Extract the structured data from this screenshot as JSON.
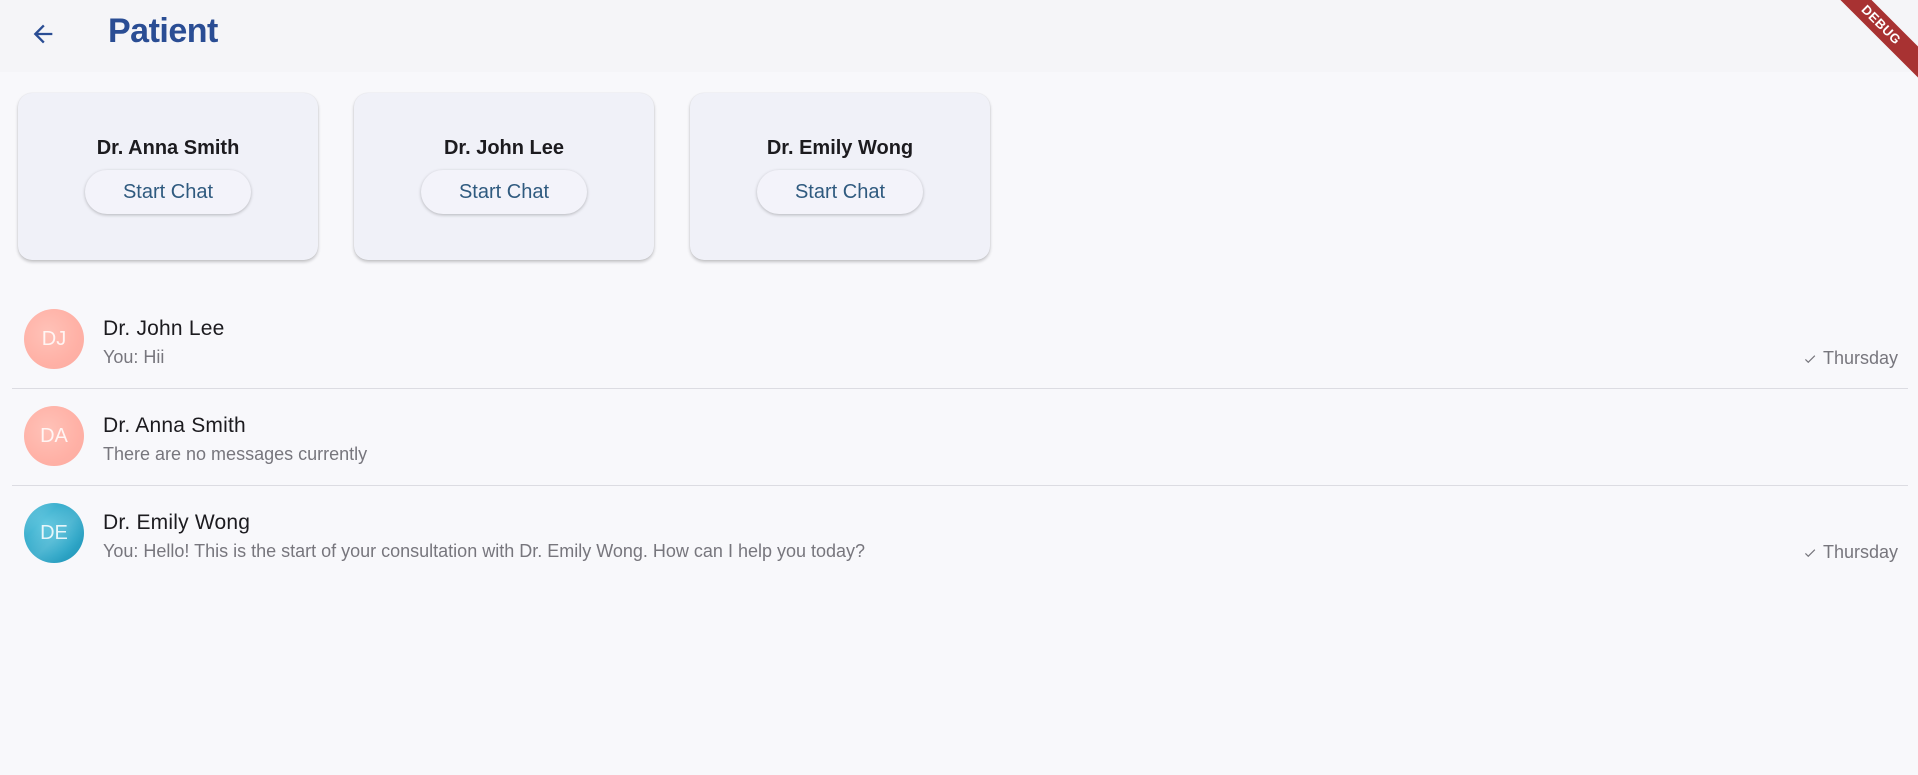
{
  "appbar": {
    "back_icon": "arrow-back-icon",
    "title": "Patient",
    "title_color": "#2a4d94"
  },
  "debug_banner": "DEBUG",
  "doctor_cards": [
    {
      "name": "Dr. Anna Smith",
      "button_label": "Start Chat"
    },
    {
      "name": "Dr. John Lee",
      "button_label": "Start Chat"
    },
    {
      "name": "Dr. Emily Wong",
      "button_label": "Start Chat"
    }
  ],
  "chats": [
    {
      "initials": "DJ",
      "avatar_color": "#ffb1a6",
      "name": "Dr. John Lee",
      "preview": "You: Hii",
      "status_icon": "check-icon",
      "time": "Thursday"
    },
    {
      "initials": "DA",
      "avatar_color": "#ffb1a6",
      "name": "Dr. Anna Smith",
      "preview": "There are no messages currently"
    },
    {
      "initials": "DE",
      "avatar_color": "#2ea7c8",
      "name": "Dr. Emily Wong",
      "preview": "You: Hello! This is the start of your consultation with Dr. Emily Wong. How can I help you today?",
      "status_icon": "check-icon",
      "time": "Thursday"
    }
  ]
}
